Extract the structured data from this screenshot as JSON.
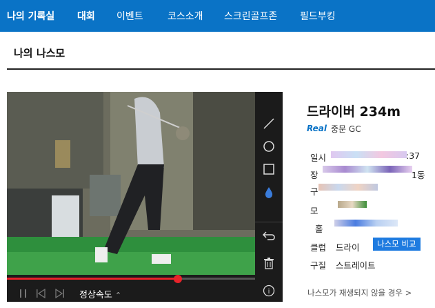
{
  "nav": {
    "items": [
      {
        "label": "나의 기록실",
        "bold": true
      },
      {
        "label": "대회",
        "bold": true
      },
      {
        "label": "이벤트",
        "bold": false
      },
      {
        "label": "코스소개",
        "bold": false
      },
      {
        "label": "스크린골프존",
        "bold": false
      },
      {
        "label": "필드부킹",
        "bold": false
      }
    ]
  },
  "page": {
    "title": "나의 나스모"
  },
  "player": {
    "speed_label": "정상속도",
    "progress_fraction": 0.69,
    "tools": [
      "line-icon",
      "circle-icon",
      "square-icon",
      "drop-icon",
      "undo-icon",
      "trash-icon",
      "info-icon"
    ]
  },
  "shot": {
    "title": "드라이버 234m",
    "course_logo": "Real",
    "course_name": "중문 GC",
    "rows": {
      "date_label": "일시",
      "date_value_tail": ":37",
      "place_label": "장",
      "place_value_tail": "1동",
      "g_label": "구",
      "mode_label": "모",
      "hole_label": "홀",
      "club_label": "클럽",
      "club_value": "드라이",
      "ball_label": "구질",
      "ball_value": "스트레이트"
    },
    "compare_button": "나스모 비교",
    "help_link": "나스모가 재생되지 않을 경우 >"
  },
  "colors": {
    "brand": "#0a73c6",
    "progress": "#e8232a",
    "compare": "#1e7be0"
  }
}
